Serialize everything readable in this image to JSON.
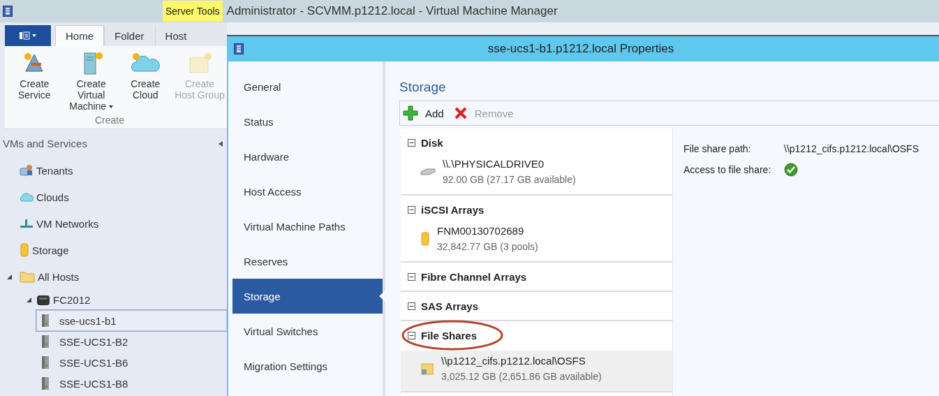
{
  "app_title": "Administrator - SCVMM.p1212.local - Virtual Machine Manager",
  "contextual_tab": "Server Tools",
  "ribbon_tabs": [
    {
      "label": "Home",
      "selected": true
    },
    {
      "label": "Folder",
      "selected": false
    },
    {
      "label": "Host",
      "selected": false
    }
  ],
  "ribbon_buttons": [
    {
      "label": "Create Service",
      "dropdown": false,
      "disabled": false
    },
    {
      "label": "Create Virtual Machine",
      "dropdown": true,
      "disabled": false
    },
    {
      "label": "Create Cloud",
      "dropdown": false,
      "disabled": false
    },
    {
      "label": "Create Host Group",
      "dropdown": false,
      "disabled": true
    }
  ],
  "ribbon_group": "Create",
  "navigation": {
    "title": "VMs and Services",
    "tree": [
      {
        "label": "Tenants",
        "selected": false
      },
      {
        "label": "Clouds",
        "selected": false
      },
      {
        "label": "VM Networks",
        "selected": false
      },
      {
        "label": "Storage",
        "selected": false
      },
      {
        "label": "All Hosts",
        "selected": false,
        "expanded": true,
        "children": [
          {
            "label": "FC2012",
            "selected": false,
            "expanded": true,
            "children": [
              {
                "label": "sse-ucs1-b1",
                "selected": true
              },
              {
                "label": "SSE-UCS1-B2",
                "selected": false
              },
              {
                "label": "SSE-UCS1-B6",
                "selected": false
              },
              {
                "label": "SSE-UCS1-B8",
                "selected": false
              }
            ]
          }
        ]
      }
    ]
  },
  "dialog": {
    "title": "sse-ucs1-b1.p1212.local Properties",
    "pages": [
      {
        "label": "General",
        "selected": false
      },
      {
        "label": "Status",
        "selected": false
      },
      {
        "label": "Hardware",
        "selected": false
      },
      {
        "label": "Host Access",
        "selected": false
      },
      {
        "label": "Virtual Machine Paths",
        "selected": false
      },
      {
        "label": "Reserves",
        "selected": false
      },
      {
        "label": "Storage",
        "selected": true
      },
      {
        "label": "Virtual Switches",
        "selected": false
      },
      {
        "label": "Migration Settings",
        "selected": false
      }
    ],
    "heading": "Storage",
    "toolbar": [
      {
        "label": "Add",
        "disabled": false
      },
      {
        "label": "Remove",
        "disabled": true
      }
    ],
    "sections": [
      {
        "title": "Disk",
        "expanded": true,
        "items": [
          {
            "name": "\\\\.\\PHYSICALDRIVE0",
            "detail": "92.00 GB (27.17 GB available)",
            "selected": false
          }
        ]
      },
      {
        "title": "iSCSI Arrays",
        "expanded": true,
        "items": [
          {
            "name": "FNM00130702689",
            "detail": "32,842.77 GB (3 pools)",
            "selected": false
          }
        ]
      },
      {
        "title": "Fibre Channel Arrays",
        "expanded": true
      },
      {
        "title": "SAS Arrays",
        "expanded": true
      },
      {
        "title": "File Shares",
        "expanded": true,
        "highlighted": true,
        "items": [
          {
            "name": "\\\\p1212_cifs.p1212.local\\OSFS",
            "detail": "3,025.12 GB (2,651.86 GB available)",
            "selected": true
          }
        ]
      }
    ],
    "details": [
      {
        "label": "File share path:",
        "value": "\\\\p1212_cifs.p1212.local\\OSFS",
        "kind": "text"
      },
      {
        "label": "Access to file share:",
        "kind": "check",
        "ok": true
      }
    ]
  }
}
